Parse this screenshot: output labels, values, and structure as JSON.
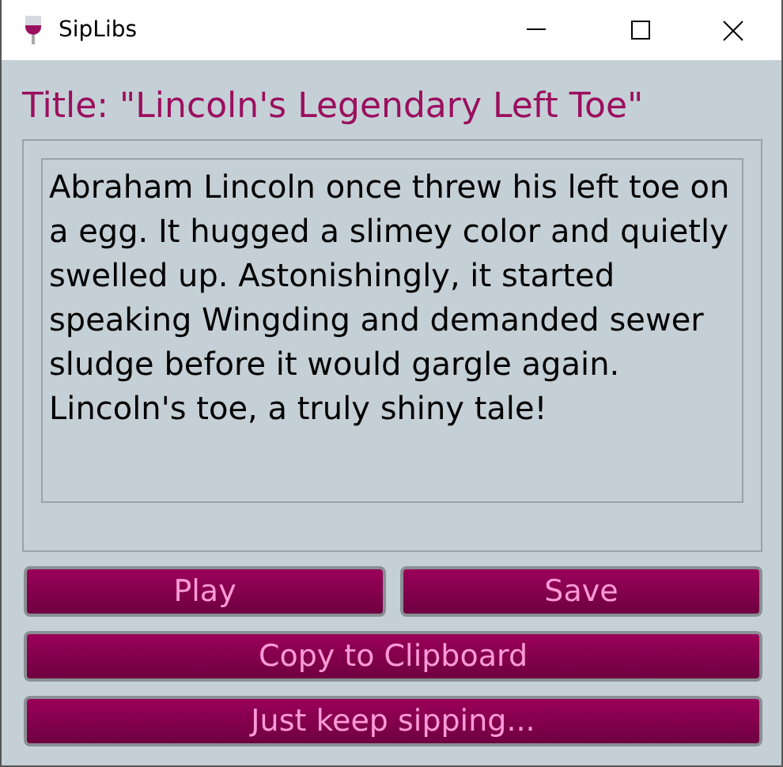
{
  "window": {
    "title": "SipLibs"
  },
  "title_label": "Title: \"Lincoln's Legendary Left Toe\"",
  "story": "Abraham Lincoln once threw his left toe on a egg. It hugged a slimey color and quietly swelled up. Astonishingly, it started speaking Wingding and demanded sewer sludge before it would gargle again. Lincoln's toe, a truly shiny tale!",
  "button_rows": [
    [
      "Play",
      "Save"
    ],
    [
      "Copy to Clipboard"
    ],
    [
      "Just keep sipping..."
    ]
  ]
}
